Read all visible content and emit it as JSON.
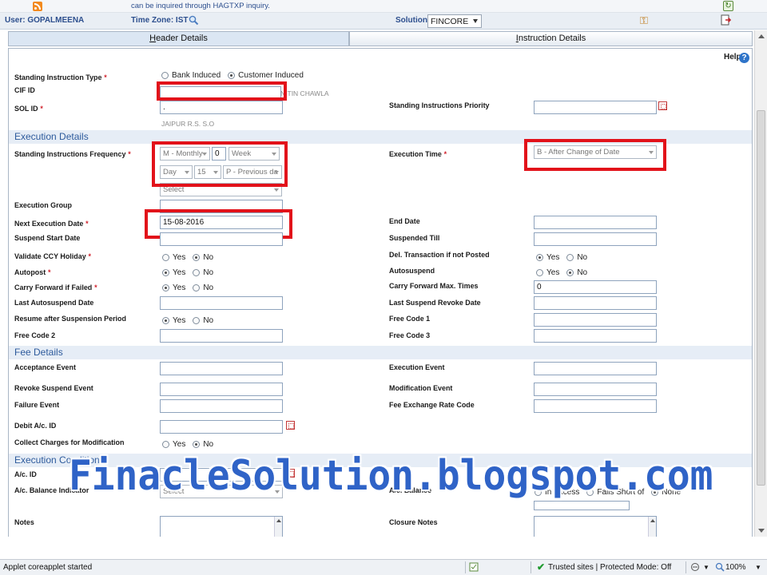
{
  "banner": {
    "text": "can be inquired through HAGTXP inquiry."
  },
  "userbar": {
    "user": "User: GOPALMEENA",
    "timezone": "Time Zone:  IST",
    "solution_label": "Solution:",
    "solution_value": "FINCORE"
  },
  "tabs": [
    {
      "label": "Header Details",
      "underline": "H",
      "rest": "eader Details"
    },
    {
      "label": "Instruction Details",
      "underline": "I",
      "rest": "nstruction Details"
    }
  ],
  "help": "Help",
  "header": {
    "si_type_label": "Standing Instruction Type",
    "si_type_options": [
      "Bank Induced",
      "Customer Induced"
    ],
    "si_type_selected": "Customer Induced",
    "cif_label": "CIF ID",
    "cif_value": "",
    "cif_name": "NITIN CHAWLA",
    "sol_label": "SOL ID",
    "sol_value": ".",
    "sol_name": "JAIPUR R.S. S.O",
    "priority_label": "Standing Instructions Priority",
    "priority_value": ""
  },
  "sections": {
    "execution_details": "Execution Details",
    "fee_details": "Fee Details",
    "execution_conditions": "Execution Conditions"
  },
  "execution": {
    "frequency_label": "Standing Instructions Frequency",
    "freq_type": "M - Monthly",
    "freq_count": "0",
    "freq_week": "Week",
    "freq_day_label": "Day",
    "freq_day": "15",
    "freq_holiday": "P - Previous da",
    "freq_extra": "Select",
    "execution_time_label": "Execution Time",
    "execution_time_value": "B - After Change of Date",
    "execution_group_label": "Execution Group",
    "next_exec_label": "Next Execution Date",
    "next_exec_value": "15-08-2016",
    "end_date_label": "End Date",
    "suspend_start_label": "Suspend Start Date",
    "suspended_till_label": "Suspended Till",
    "validate_ccy_label": "Validate CCY Holiday",
    "del_txn_label": "Del. Transaction if not Posted",
    "autopost_label": "Autopost",
    "autosuspend_label": "Autosuspend",
    "carry_forward_label": "Carry Forward if Failed",
    "carry_max_label": "Carry Forward Max. Times",
    "carry_max_value": "0",
    "last_autosuspend_label": "Last Autosuspend Date",
    "last_revoke_label": "Last Suspend Revoke Date",
    "resume_label": "Resume after Suspension Period",
    "free_code1_label": "Free Code 1",
    "free_code2_label": "Free Code 2",
    "free_code3_label": "Free Code 3",
    "yes": "Yes",
    "no": "No"
  },
  "fees": {
    "acceptance_label": "Acceptance Event",
    "execution_event_label": "Execution Event",
    "revoke_label": "Revoke Suspend Event",
    "modification_label": "Modification Event",
    "failure_label": "Failure Event",
    "fee_rate_label": "Fee Exchange Rate Code",
    "debit_label": "Debit A/c. ID",
    "collect_label": "Collect Charges for Modification"
  },
  "conditions": {
    "ac_id_label": "A/c. ID",
    "ac_balance_label": "A/c. Balance Indicator",
    "ac_balance_right_label": "A/c. Balance",
    "select_text": "Select",
    "right_options": [
      "In Excess",
      "Falls Short of",
      "None"
    ],
    "notes_label": "Notes",
    "closure_notes_label": "Closure Notes"
  },
  "statusbar": {
    "left": "Applet coreapplet started",
    "trusted": "Trusted sites | Protected Mode: Off",
    "zoom": "100%"
  },
  "watermark": "FinacleSolution.blogspot.com",
  "colors": {
    "accent": "#2d4f8e",
    "section_bg": "#e6edf6",
    "required": "#d0202a",
    "highlight_box": "#e2121a",
    "watermark": "#2f63c7"
  }
}
